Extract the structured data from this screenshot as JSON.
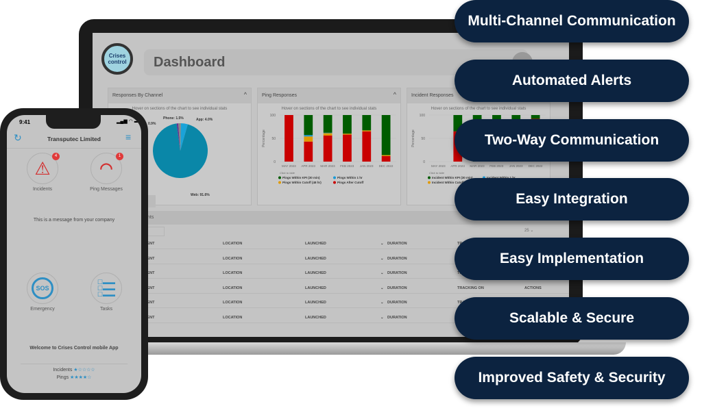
{
  "dashboard": {
    "title": "Dashboard",
    "logo_text": "Crises Control"
  },
  "cards": [
    {
      "title": "Responses By Channel",
      "hint": "Hover on sections of the chart to see individual stats"
    },
    {
      "title": "Ping Responses",
      "hint": "Hover on sections of the chart to see individual stats"
    },
    {
      "title": "Incident Responses",
      "hint": "Hover on sections of the chart to see individual stats"
    }
  ],
  "chart_data": [
    {
      "type": "pie",
      "labels": [
        "Web: 91.6%",
        "App: 4.0%",
        "Phone: 1.5%",
        "0.9%"
      ],
      "values": [
        91.6,
        4.0,
        1.5,
        0.9
      ],
      "colors": [
        "#0a87a8",
        "#1aa3d9",
        "#888888",
        "#6a2c91"
      ]
    },
    {
      "type": "bar",
      "stacked": true,
      "ylabel": "Percentage",
      "ylim": [
        0,
        100
      ],
      "yticks": [
        "100",
        "50",
        "0"
      ],
      "categories": [
        "MAY 2023",
        "APR 2023",
        "MAR 2023",
        "FEB 2023",
        "JAN 2023",
        "DEC 2022"
      ],
      "legend_hint": "Click to hide",
      "series": [
        {
          "name": "Pings After Cutoff",
          "color": "#c90000",
          "values": [
            100,
            43,
            56,
            58,
            65,
            12
          ]
        },
        {
          "name": "Pings Within Cutoff (48 hr)",
          "color": "#e09a00",
          "values": [
            0,
            11,
            5,
            2,
            2,
            2
          ]
        },
        {
          "name": "Pings Within 1 hr",
          "color": "#1a9ad6",
          "values": [
            0,
            3,
            1,
            0,
            0,
            0
          ]
        },
        {
          "name": "Pings Within KPI (30 min)",
          "color": "#005c00",
          "values": [
            0,
            43,
            38,
            40,
            33,
            86
          ]
        }
      ]
    },
    {
      "type": "bar",
      "stacked": true,
      "ylabel": "Percentage",
      "ylim": [
        0,
        100
      ],
      "yticks": [
        "100",
        "50",
        "0"
      ],
      "categories": [
        "MAY 2023",
        "APR 2023",
        "MAR 2023",
        "FEB 2023",
        "JAN 2023",
        "DEC 2022"
      ],
      "legend_hint": "Click to hide",
      "series": [
        {
          "name": "Incident After Cutoff",
          "color": "#c90000",
          "values": [
            0,
            65,
            0,
            0,
            0,
            92
          ]
        },
        {
          "name": "Incident Within Cutoff (48 hr)",
          "color": "#e09a00",
          "values": [
            0,
            0,
            0,
            0,
            0,
            0
          ]
        },
        {
          "name": "Incident Within 1 hr",
          "color": "#1a9ad6",
          "values": [
            0,
            0,
            0,
            0,
            0,
            0
          ]
        },
        {
          "name": "Incident Within KPI (30 min)",
          "color": "#005c00",
          "values": [
            0,
            35,
            100,
            100,
            100,
            8
          ]
        }
      ]
    }
  ],
  "table": {
    "section": "nts",
    "page_size": "25",
    "columns": [
      "CIDENT",
      "LOCATION",
      "LAUNCHED",
      "DURATION",
      "TRACKING ON",
      "ACTIONS"
    ]
  },
  "phone": {
    "time": "9:41",
    "company": "Transputec Limited",
    "tiles": [
      {
        "label": "Incidents",
        "badge": "4"
      },
      {
        "label": "Ping Messages",
        "badge": "1"
      },
      {
        "label": "Emergency",
        "icon_text": "SOS"
      },
      {
        "label": "Tasks"
      }
    ],
    "message": "This is a message from your company",
    "welcome": "Welcome to Crises Control mobile App",
    "ratings": [
      {
        "label": "Incidents",
        "stars": 1,
        "max": 5
      },
      {
        "label": "Pings",
        "stars": 4,
        "max": 5
      }
    ]
  },
  "features": [
    "Multi-Channel Communication",
    "Automated Alerts",
    "Two-Way Communication",
    "Easy Integration",
    "Easy Implementation",
    "Scalable & Secure",
    "Improved Safety & Security"
  ]
}
